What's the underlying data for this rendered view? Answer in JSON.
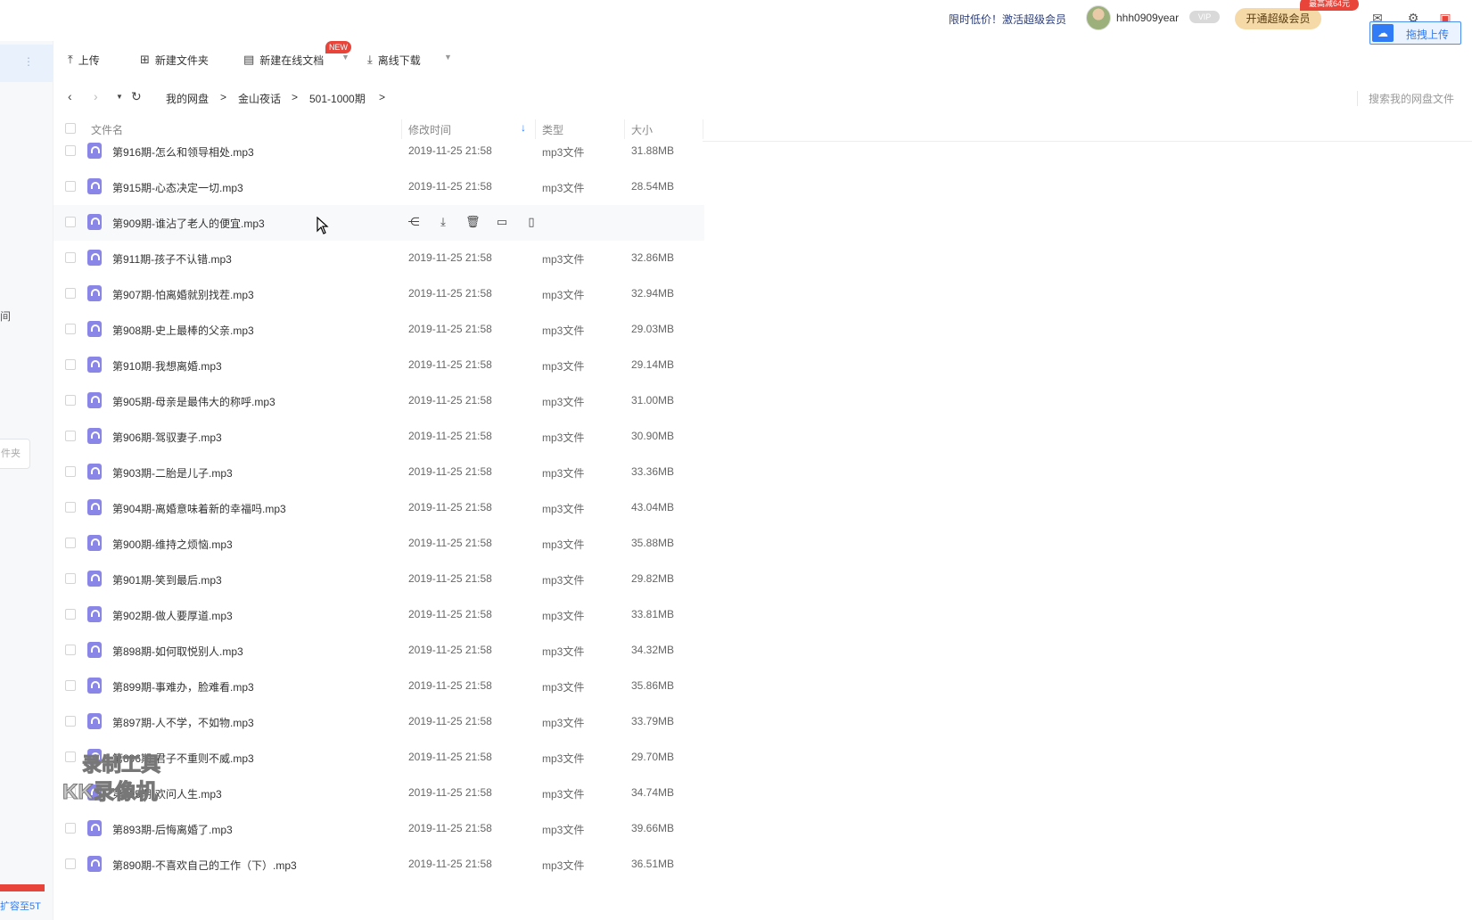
{
  "topbar": {
    "promo": "限时低价！激活超级会员",
    "username": "hhh0909year",
    "vip_badge": "VIP",
    "open_vip": "开通超级会员",
    "sale_tag": "最高减64元",
    "drag_upload": "拖拽上传"
  },
  "sidebar": {
    "fragment": "间",
    "box_label": "件夹",
    "expand": "扩容至5T"
  },
  "toolbar": {
    "upload": "上传",
    "new_folder": "新建文件夹",
    "new_online_doc": "新建在线文档",
    "new_tag": "NEW",
    "offline_download": "离线下载"
  },
  "breadcrumb": {
    "items": [
      "我的网盘",
      "金山夜话",
      "501-1000期"
    ],
    "sep": ">"
  },
  "search": {
    "placeholder": "搜索我的网盘文件"
  },
  "table": {
    "headers": {
      "name": "文件名",
      "modified": "修改时间",
      "type": "类型",
      "size": "大小"
    },
    "rows": [
      {
        "name": "第916期-怎么和领导相处.mp3",
        "time": "2019-11-25 21:58",
        "type": "mp3文件",
        "size": "31.88MB"
      },
      {
        "name": "第915期-心态决定一切.mp3",
        "time": "2019-11-25 21:58",
        "type": "mp3文件",
        "size": "28.54MB"
      },
      {
        "name": "第909期-谁沾了老人的便宜.mp3",
        "time": "",
        "type": "",
        "size": ""
      },
      {
        "name": "第911期-孩子不认错.mp3",
        "time": "2019-11-25 21:58",
        "type": "mp3文件",
        "size": "32.86MB"
      },
      {
        "name": "第907期-怕离婚就别找茬.mp3",
        "time": "2019-11-25 21:58",
        "type": "mp3文件",
        "size": "32.94MB"
      },
      {
        "name": "第908期-史上最棒的父亲.mp3",
        "time": "2019-11-25 21:58",
        "type": "mp3文件",
        "size": "29.03MB"
      },
      {
        "name": "第910期-我想离婚.mp3",
        "time": "2019-11-25 21:58",
        "type": "mp3文件",
        "size": "29.14MB"
      },
      {
        "name": "第905期-母亲是最伟大的称呼.mp3",
        "time": "2019-11-25 21:58",
        "type": "mp3文件",
        "size": "31.00MB"
      },
      {
        "name": "第906期-驾驭妻子.mp3",
        "time": "2019-11-25 21:58",
        "type": "mp3文件",
        "size": "30.90MB"
      },
      {
        "name": "第903期-二胎是儿子.mp3",
        "time": "2019-11-25 21:58",
        "type": "mp3文件",
        "size": "33.36MB"
      },
      {
        "name": "第904期-离婚意味着新的幸福吗.mp3",
        "time": "2019-11-25 21:58",
        "type": "mp3文件",
        "size": "43.04MB"
      },
      {
        "name": "第900期-维持之烦恼.mp3",
        "time": "2019-11-25 21:58",
        "type": "mp3文件",
        "size": "35.88MB"
      },
      {
        "name": "第901期-笑到最后.mp3",
        "time": "2019-11-25 21:58",
        "type": "mp3文件",
        "size": "29.82MB"
      },
      {
        "name": "第902期-做人要厚道.mp3",
        "time": "2019-11-25 21:58",
        "type": "mp3文件",
        "size": "33.81MB"
      },
      {
        "name": "第898期-如何取悦别人.mp3",
        "time": "2019-11-25 21:58",
        "type": "mp3文件",
        "size": "34.32MB"
      },
      {
        "name": "第899期-事难办，脸难看.mp3",
        "time": "2019-11-25 21:58",
        "type": "mp3文件",
        "size": "35.86MB"
      },
      {
        "name": "第897期-人不学，不如物.mp3",
        "time": "2019-11-25 21:58",
        "type": "mp3文件",
        "size": "33.79MB"
      },
      {
        "name": "第896期-君子不重则不威.mp3",
        "time": "2019-11-25 21:58",
        "type": "mp3文件",
        "size": "29.70MB"
      },
      {
        "name": "第895期-欢问人生.mp3",
        "time": "2019-11-25 21:58",
        "type": "mp3文件",
        "size": "34.74MB"
      },
      {
        "name": "第893期-后悔离婚了.mp3",
        "time": "2019-11-25 21:58",
        "type": "mp3文件",
        "size": "39.66MB"
      },
      {
        "name": "第890期-不喜欢自己的工作（下）.mp3",
        "time": "2019-11-25 21:58",
        "type": "mp3文件",
        "size": "36.51MB"
      }
    ]
  },
  "watermark": {
    "line1": "录制工具",
    "line2": "KK录像机"
  },
  "colors": {
    "accent": "#2f7cf6",
    "file_icon": "#8a86e8",
    "sale": "#e8443a",
    "vip_gold": "#f5d9a6"
  }
}
